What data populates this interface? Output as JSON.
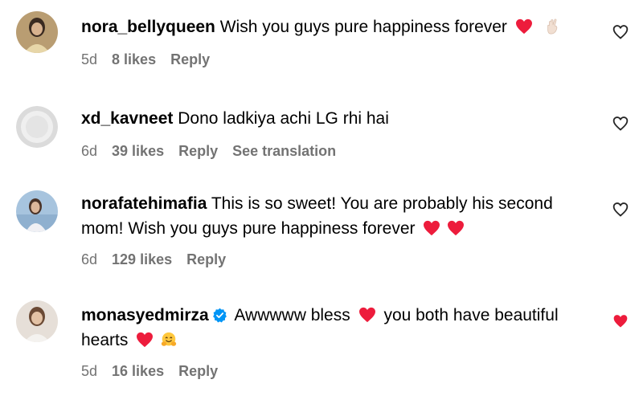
{
  "comments": [
    {
      "username": "nora_bellyqueen",
      "text": "Wish you guys pure happiness forever",
      "time": "5d",
      "likes": "8 likes",
      "reply": "Reply",
      "liked": false
    },
    {
      "username": "xd_kavneet",
      "text": "Dono ladkiya achi LG rhi hai",
      "time": "6d",
      "likes": "39 likes",
      "reply": "Reply",
      "translate": "See translation",
      "liked": false
    },
    {
      "username": "norafatehimafia",
      "text_line1": "This is so sweet! You are probably his second",
      "text_line2": "mom! Wish you guys pure happiness forever",
      "time": "6d",
      "likes": "129 likes",
      "reply": "Reply",
      "liked": false
    },
    {
      "username": "monasyedmirza",
      "text_part1": "Awwwww bless",
      "text_part2": "you both have beautiful",
      "text_line2": "hearts",
      "time": "5d",
      "likes": "16 likes",
      "reply": "Reply",
      "liked": true
    }
  ],
  "colors": {
    "heart_red": "#ed1c3c",
    "meta_gray": "#737373",
    "verified_blue": "#0095f6"
  }
}
